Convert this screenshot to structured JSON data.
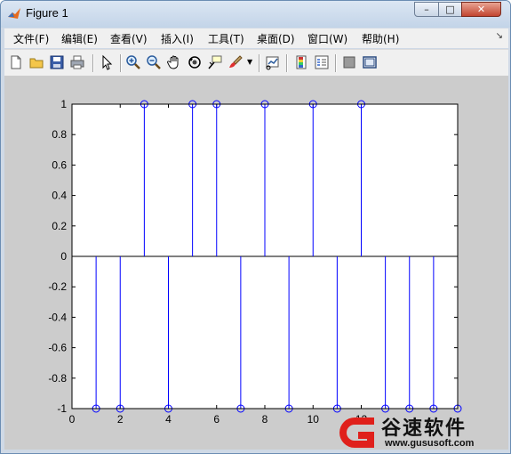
{
  "window": {
    "title": "Figure 1",
    "buttons": {
      "minimize": "–",
      "maximize": "□",
      "close": "✕"
    }
  },
  "menu": [
    "文件(F)",
    "编辑(E)",
    "查看(V)",
    "插入(I)",
    "工具(T)",
    "桌面(D)",
    "窗口(W)",
    "帮助(H)"
  ],
  "toolbar": {
    "icons": [
      "new-figure-icon",
      "open-file-icon",
      "save-icon",
      "print-icon",
      "pointer-icon",
      "zoom-in-icon",
      "zoom-out-icon",
      "pan-icon",
      "rotate-3d-icon",
      "data-cursor-icon",
      "brush-icon",
      "link-plot-icon",
      "colorbar-icon",
      "legend-icon",
      "hide-plot-tools-icon",
      "show-plot-tools-icon"
    ]
  },
  "chart_data": {
    "type": "stem",
    "x": [
      1,
      2,
      3,
      4,
      5,
      6,
      7,
      8,
      9,
      10,
      11,
      12,
      13,
      14,
      15,
      16
    ],
    "y": [
      -1,
      -1,
      1,
      -1,
      1,
      1,
      -1,
      1,
      -1,
      1,
      -1,
      1,
      -1,
      -1,
      -1,
      -1
    ],
    "xlim": [
      0,
      16
    ],
    "ylim": [
      -1,
      1
    ],
    "xticks": [
      0,
      2,
      4,
      6,
      8,
      10,
      12
    ],
    "yticks": [
      1,
      0.8,
      0.6,
      0.4,
      0.2,
      0,
      -0.2,
      -0.4,
      -0.6,
      -0.8,
      -1
    ],
    "color": "#0000ff",
    "marker": "circle-open",
    "title": "",
    "xlabel": "",
    "ylabel": ""
  },
  "watermark": {
    "title": "谷速软件",
    "url": "www.gususoft.com",
    "color": "#e0201b"
  }
}
